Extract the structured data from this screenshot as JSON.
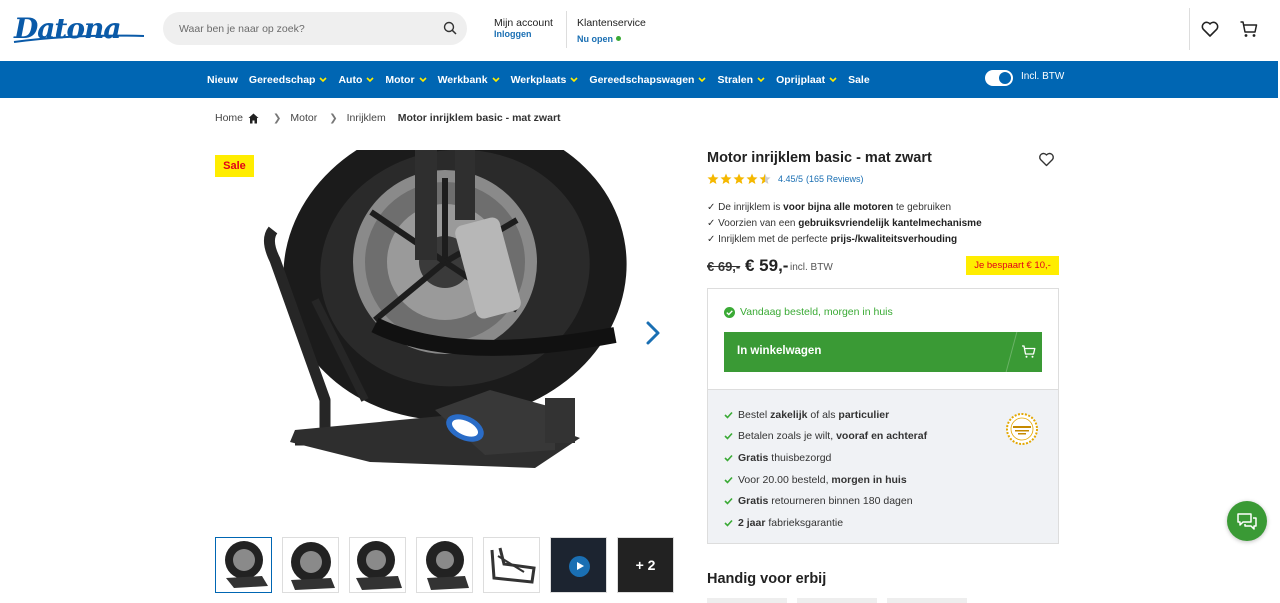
{
  "header": {
    "logo_text": "Datona",
    "search": {
      "placeholder": "Waar ben je naar op zoek?"
    },
    "account": {
      "title": "Mijn account",
      "action": "Inloggen"
    },
    "service": {
      "title": "Klantenservice",
      "status": "Nu open",
      "status_color": "#3aaa35"
    }
  },
  "nav": {
    "items": [
      {
        "label": "Nieuw",
        "dropdown": false
      },
      {
        "label": "Gereedschap",
        "dropdown": true
      },
      {
        "label": "Auto",
        "dropdown": true
      },
      {
        "label": "Motor",
        "dropdown": true
      },
      {
        "label": "Werkbank",
        "dropdown": true
      },
      {
        "label": "Werkplaats",
        "dropdown": true
      },
      {
        "label": "Gereedschapswagen",
        "dropdown": true
      },
      {
        "label": "Stralen",
        "dropdown": true
      },
      {
        "label": "Oprijplaat",
        "dropdown": true
      },
      {
        "label": "Sale",
        "dropdown": false
      }
    ],
    "vat_toggle_label": "Incl. BTW",
    "vat_toggle_on": true
  },
  "breadcrumb": {
    "home": "Home",
    "items": [
      "Motor",
      "Inrijklem"
    ],
    "current": "Motor inrijklem basic - mat zwart"
  },
  "gallery": {
    "sale_badge": "Sale",
    "thumbnail_count": 7,
    "more_label": "+ 2"
  },
  "product": {
    "title": "Motor inrijklem basic - mat zwart",
    "rating_value": 4.45,
    "rating_text": "4.45/5",
    "reviews_text": "(165 Reviews)",
    "usps": [
      {
        "prefix": "✓ De inrijklem is ",
        "bold": "voor bijna alle motoren",
        "suffix": " te gebruiken"
      },
      {
        "prefix": "✓ Voorzien van een ",
        "bold": "gebruiksvriendelijk kantelmechanisme",
        "suffix": ""
      },
      {
        "prefix": "✓ Inrijklem met de perfecte ",
        "bold": "prijs-/kwaliteitsverhouding",
        "suffix": ""
      }
    ],
    "old_price": "€ 69,-",
    "price": "€ 59,-",
    "price_note": "incl. BTW",
    "saved_label": "Je bespaart € 10,-"
  },
  "buybox": {
    "delivery": "Vandaag besteld, morgen in huis",
    "cart_button": "In winkelwagen",
    "benefits": [
      {
        "parts": [
          [
            "Bestel ",
            false
          ],
          [
            "zakelijk",
            true
          ],
          [
            " of als ",
            false
          ],
          [
            "particulier",
            true
          ]
        ]
      },
      {
        "parts": [
          [
            "Betalen zoals je wilt, ",
            false
          ],
          [
            "vooraf en achteraf",
            true
          ]
        ]
      },
      {
        "parts": [
          [
            "Gratis",
            true
          ],
          [
            " thuisbezorgd",
            false
          ]
        ]
      },
      {
        "parts": [
          [
            "Voor 20.00 besteld, ",
            false
          ],
          [
            "morgen in huis",
            true
          ]
        ]
      },
      {
        "parts": [
          [
            "Gratis",
            true
          ],
          [
            " retourneren binnen 180 dagen",
            false
          ]
        ]
      },
      {
        "parts": [
          [
            "2 jaar",
            true
          ],
          [
            " fabrieksgarantie",
            false
          ]
        ]
      }
    ]
  },
  "section_title": "Handig voor erbij",
  "colors": {
    "brand_blue": "#0066b3",
    "green": "#3a9a35",
    "sale_yellow": "#ffed00",
    "sale_red": "#e2001a"
  }
}
